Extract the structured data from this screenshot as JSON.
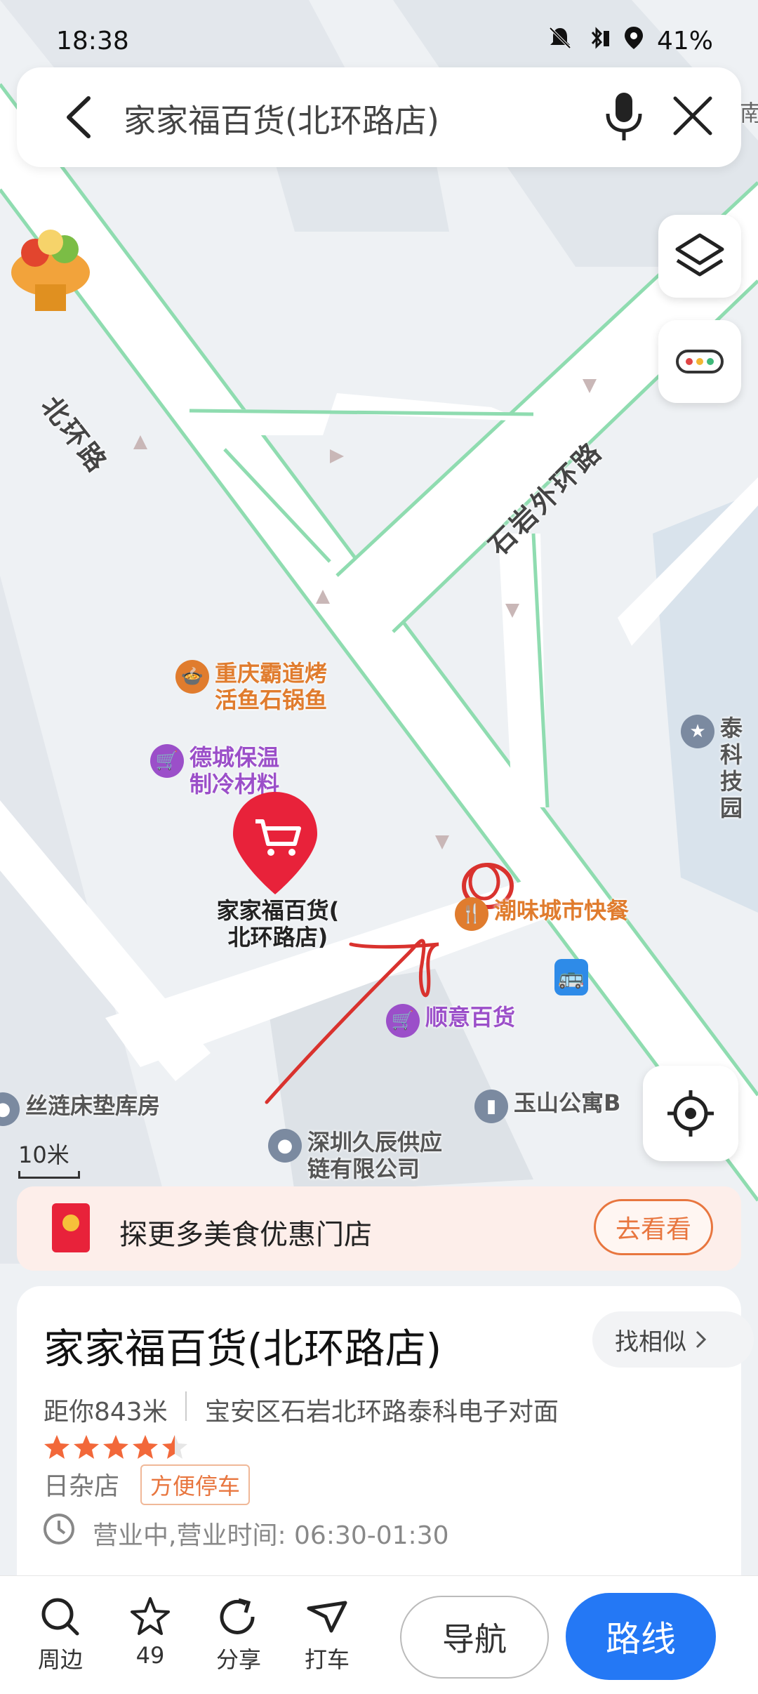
{
  "status": {
    "time": "18:38",
    "battery": "41%"
  },
  "search": {
    "query": "家家福百货(北环路店)"
  },
  "map": {
    "roads": [
      "北环路",
      "石岩外环路"
    ],
    "pois": [
      {
        "name_lines": [
          "重庆霸道烤",
          "活鱼石锅鱼"
        ],
        "color": "#e07c2e",
        "icon": "food-icon"
      },
      {
        "name_lines": [
          "德城保温",
          "制冷材料"
        ],
        "color": "#9b4fc9",
        "icon": "shop-cart-icon"
      },
      {
        "name_lines": [
          "家家福百货(",
          "北环路店)"
        ],
        "color": "#222222",
        "icon": "shop-cart-icon"
      },
      {
        "name_lines": [
          "潮味城市快餐"
        ],
        "color": "#e07c2e",
        "icon": "food-icon"
      },
      {
        "name_lines": [
          "顺意百货"
        ],
        "color": "#9b4fc9",
        "icon": "shop-cart-icon"
      },
      {
        "name_lines": [
          "丝涟床垫库房"
        ],
        "color": "#666666",
        "icon": "location-icon"
      },
      {
        "name_lines": [
          "玉山公寓B"
        ],
        "color": "#666666",
        "icon": "building-icon"
      },
      {
        "name_lines": [
          "深圳久辰供应",
          "链有限公司"
        ],
        "color": "#666666",
        "icon": "location-icon"
      },
      {
        "name_lines": [
          "泰科",
          "技园"
        ],
        "color": "#666666",
        "icon": "star-icon"
      },
      {
        "name_lines": [
          "南"
        ],
        "color": "#666666",
        "icon": ""
      }
    ],
    "scale": "10米"
  },
  "promo": {
    "text": "探更多美食优惠门店",
    "button": "去看看"
  },
  "place": {
    "title": "家家福百货(北环路店)",
    "similar": "找相似",
    "distance": "距你843米",
    "address": "宝安区石岩北环路泰科电子对面",
    "rating": 4.5,
    "category": "日杂店",
    "tag": "方便停车",
    "hours": "营业中,营业时间: 06:30-01:30"
  },
  "bottom": {
    "items": [
      {
        "label": "周边",
        "icon": "search-icon"
      },
      {
        "label": "49",
        "icon": "star-icon"
      },
      {
        "label": "分享",
        "icon": "share-icon"
      },
      {
        "label": "打车",
        "icon": "taxi-icon"
      }
    ],
    "navigate": "导航",
    "route": "路线"
  },
  "colors": {
    "accent": "#2478f5",
    "promo": "#e8763f",
    "road_edge": "#8fdcb0",
    "pin": "#e8223a"
  }
}
